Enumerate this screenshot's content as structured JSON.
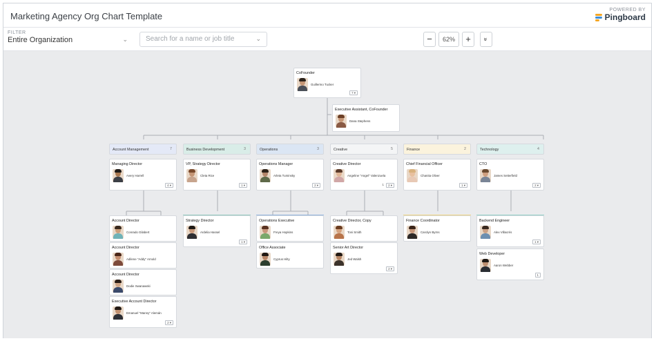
{
  "header": {
    "title": "Marketing Agency Org Chart Template",
    "powered_by": "POWERED BY",
    "brand_name": "Pingboard"
  },
  "toolbar": {
    "filter_label": "FILTER",
    "filter_value": "Entire Organization",
    "search_placeholder": "Search for a name or job title",
    "zoom_out": "−",
    "zoom_level": "62%",
    "zoom_in": "+",
    "expand": "»"
  },
  "colors": {
    "canvas": "#eaebed",
    "account_management": "#e4e9f7",
    "business_development": "#d9ede8",
    "operations": "#dbe6f4",
    "creative": "#f4f5f6",
    "finance": "#fbf3dd",
    "technology": "#def0ee"
  },
  "top": {
    "cofounder": {
      "role": "CoFounder",
      "name": "Guillermo Tucker",
      "count": "7 ▾"
    },
    "assistant": {
      "role": "Executive Assistant, CoFounder",
      "name": "Dana Stephens"
    }
  },
  "departments": [
    {
      "name": "Account Management",
      "count": "7"
    },
    {
      "name": "Business Development",
      "count": "3"
    },
    {
      "name": "Operations",
      "count": "3"
    },
    {
      "name": "Creative",
      "count": "5"
    },
    {
      "name": "Finance",
      "count": "2"
    },
    {
      "name": "Technology",
      "count": "4"
    }
  ],
  "leaders": [
    {
      "role": "Managing Director",
      "name": "Avery Harrell",
      "count": "4 ▾"
    },
    {
      "role": "VP, Strategy Director",
      "name": "Cleta Rice",
      "count": "1 ▾"
    },
    {
      "role": "Operations Manager",
      "name": "Arleta Tuminsky",
      "count": "2 ▾"
    },
    {
      "role": "Creative Director",
      "name": "Angeline \"Angel\" Valenzuela",
      "count": "2 ▾",
      "count_extra": "1"
    },
    {
      "role": "Chief Financial Officer",
      "name": "Chanita Oliver",
      "count": "1 ▾"
    },
    {
      "role": "CTO",
      "name": "James Setterfield",
      "count": "2 ▾"
    }
  ],
  "reports": {
    "account": [
      {
        "role": "Account Director",
        "name": "Conrado Gilabert"
      },
      {
        "role": "Account Director",
        "name": "Adilene \"Addy\" Arnold"
      },
      {
        "role": "Account Director",
        "name": "Dodie Swanawski"
      },
      {
        "role": "Executive Account Director",
        "name": "Emanuel \"Manny\" Alemán",
        "count": "2 ▾"
      }
    ],
    "bizdev": [
      {
        "role": "Strategy Director",
        "name": "Ardelia Hassel",
        "count": "1 ▾"
      }
    ],
    "operations": [
      {
        "role": "Operations Executive",
        "name": "Freya Hopkins"
      },
      {
        "role": "Office Associate",
        "name": "Cyprus Hilty"
      }
    ],
    "creative": [
      {
        "role": "Creative Director, Copy",
        "name": "Toni Smith"
      },
      {
        "role": "Senior Art Director",
        "name": "Jed Walsh",
        "count": "2 ▾"
      }
    ],
    "finance": [
      {
        "role": "Finance Coordinator",
        "name": "Carolyn Byrns"
      }
    ],
    "technology": [
      {
        "role": "Backend Engineer",
        "name": "Alex Villacrés",
        "count": "1 ▾"
      },
      {
        "role": "Web Developer",
        "name": "Aaron Webber",
        "count": "1"
      }
    ]
  }
}
